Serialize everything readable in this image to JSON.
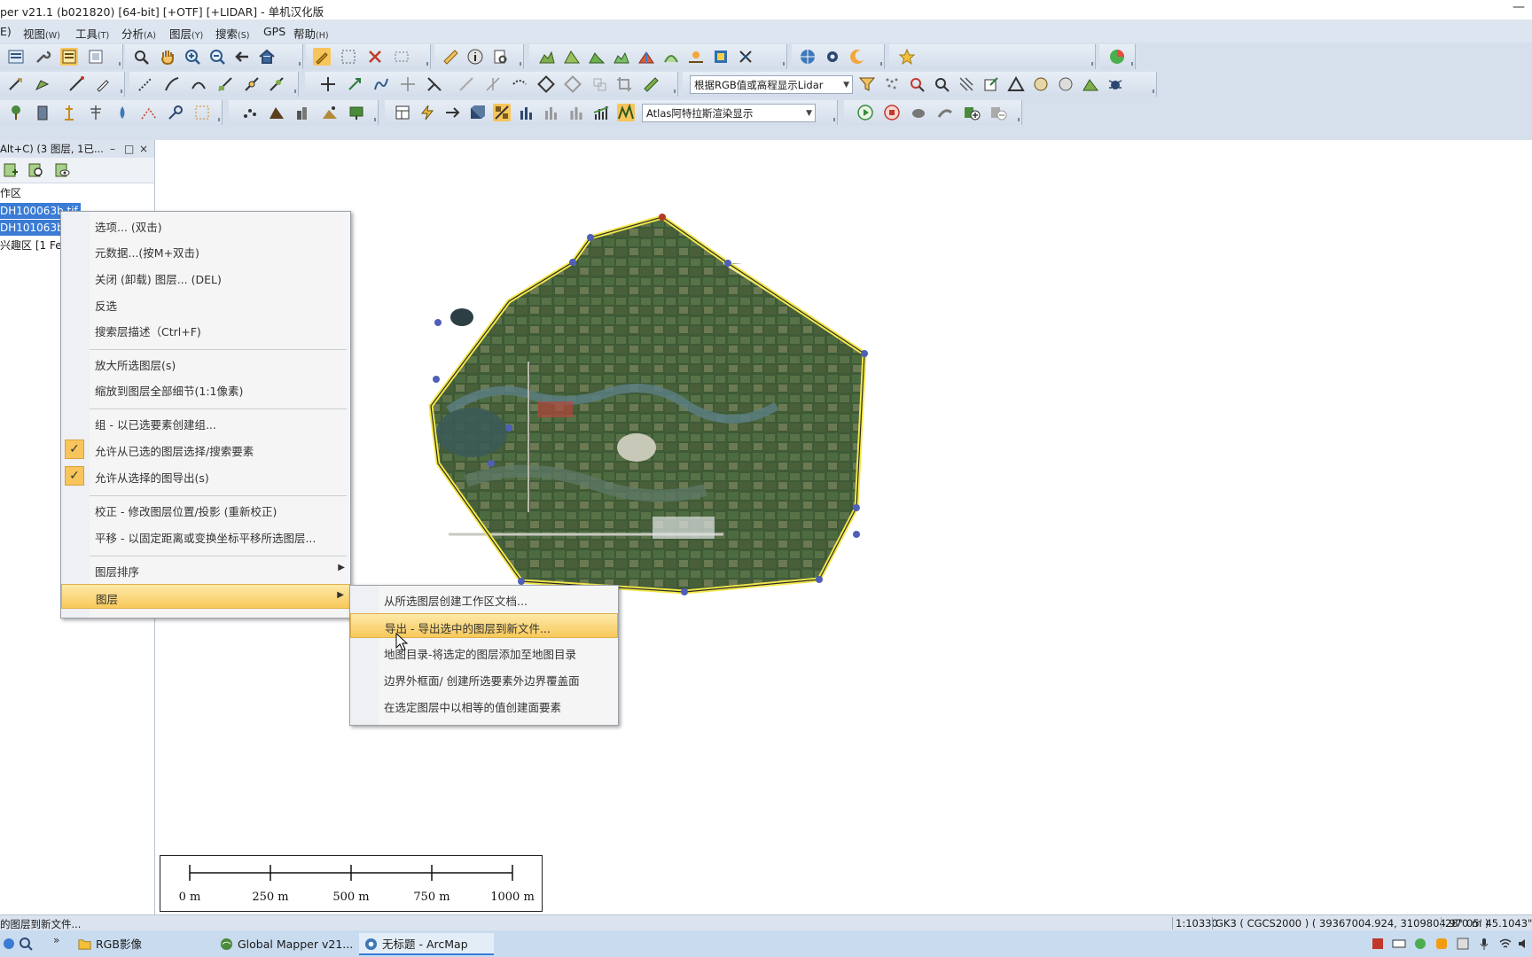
{
  "window": {
    "title": "per v21.1 (b021820) [64-bit] [+OTF] [+LIDAR] - 单机汉化版",
    "minimize": "—"
  },
  "menubar": [
    {
      "label": "E)",
      "acc": ""
    },
    {
      "label": "视图",
      "acc": "(W)"
    },
    {
      "label": "工具",
      "acc": "(T)"
    },
    {
      "label": "分析",
      "acc": "(A)"
    },
    {
      "label": "图层",
      "acc": "(Y)"
    },
    {
      "label": "搜索",
      "acc": "(S)"
    },
    {
      "label": "GPS",
      "acc": ""
    },
    {
      "label": "帮助",
      "acc": "(H)"
    }
  ],
  "toolbar": {
    "render_combo": "根据RGB值或高程显示Lidar",
    "atlas_combo": "Atlas阿特拉斯渲染显示"
  },
  "control_center": {
    "header": "Alt+C)  (3 图层, 1已...",
    "header_buttons": [
      "–",
      "□",
      "×"
    ],
    "items": [
      {
        "label": "作区",
        "selected": false
      },
      {
        "label": "DH100063b.tif",
        "selected": true
      },
      {
        "label": "DH101063b.tif",
        "selected": true
      },
      {
        "label": "兴趣区 [1 Fe",
        "selected": false
      }
    ]
  },
  "context_menu": {
    "items": [
      {
        "label": "选项... (双击)",
        "checked": false
      },
      {
        "label": "元数据...(按M+双击)",
        "checked": false
      },
      {
        "label": "关闭 (卸载) 图层... (DEL)",
        "checked": false
      },
      {
        "label": "反选",
        "checked": false
      },
      {
        "label": "搜索层描述（Ctrl+F)",
        "checked": false
      },
      {
        "label": "放大所选图层(s)",
        "checked": false
      },
      {
        "label": "缩放到图层全部细节(1:1像素)",
        "checked": false
      },
      {
        "label": "组 - 以已选要素创建组...",
        "checked": false
      },
      {
        "label": "允许从已选的图层选择/搜索要素",
        "checked": true
      },
      {
        "label": "允许从选择的图导出(s)",
        "checked": true
      },
      {
        "label": "校正 - 修改图层位置/投影 (重新校正)",
        "checked": false
      },
      {
        "label": "平移 - 以固定距离或变换坐标平移所选图层...",
        "checked": false
      },
      {
        "label": "图层排序",
        "checked": false,
        "submenu": true
      },
      {
        "label": "图层",
        "checked": false,
        "submenu": true,
        "highlighted": true
      }
    ],
    "check_glyph": "✓",
    "submenu_glyph": "▶"
  },
  "submenu": {
    "items": [
      {
        "label": "从所选图层创建工作区文档..."
      },
      {
        "label": "导出 - 导出选中的图层到新文件...",
        "highlighted": true
      },
      {
        "label": "地图目录-将选定的图层添加至地图目录"
      },
      {
        "label": "边界外框面/ 创建所选要素外边界覆盖面"
      },
      {
        "label": "在选定图层中以相等的值创建面要素"
      }
    ]
  },
  "scalebar": {
    "labels": [
      "0 m",
      "250 m",
      "500 m",
      "750 m",
      "1000 m"
    ]
  },
  "statusbar": {
    "message": "的图层到新文件...",
    "scale": "1:10330",
    "projection": "GK3 ( CGCS2000 ) ( 39367004.924, 3109804.970 m )",
    "latlon": "28° 05' 45.1043\" N,"
  },
  "taskbar": {
    "tasks": [
      {
        "label": "RGB影像",
        "active": false
      },
      {
        "label": "Global Mapper v21...",
        "active": false
      },
      {
        "label": "无标题 - ArcMap",
        "active": true
      }
    ],
    "overflow": "»"
  },
  "colors": {
    "menubar": "#dce5f0",
    "selection": "#3a7bd5",
    "highlight": "#f8c95a",
    "polygon_outline": "#f2e84a",
    "vertex": "#4f5fb8"
  }
}
